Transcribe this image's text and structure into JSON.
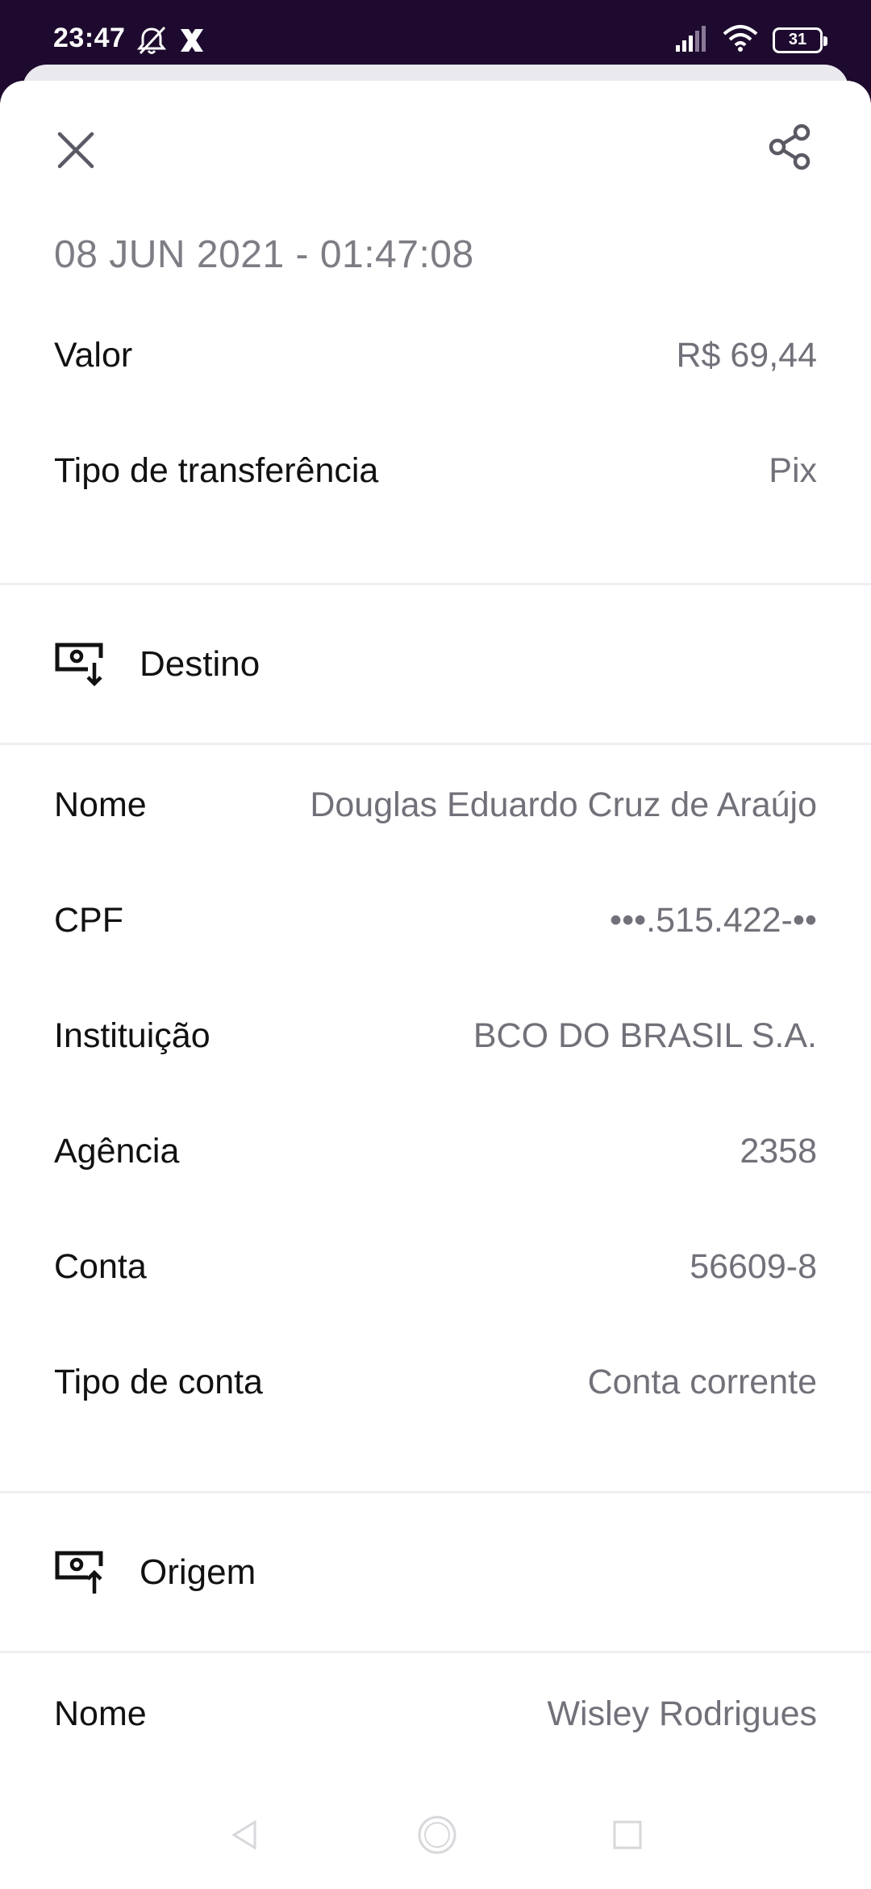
{
  "status_bar": {
    "time": "23:47",
    "battery": "31",
    "icons": [
      "alarm-off-icon",
      "x-app-icon",
      "signal-icon",
      "wifi-icon",
      "battery-icon"
    ]
  },
  "header": {
    "close_icon": "close-icon",
    "share_icon": "share-icon"
  },
  "transaction": {
    "date": "08 JUN 2021 - 01:47:08",
    "rows": [
      {
        "label": "Valor",
        "value": "R$ 69,44"
      },
      {
        "label": "Tipo de transferência",
        "value": "Pix"
      }
    ]
  },
  "destino": {
    "title": "Destino",
    "icon": "money-in-icon",
    "rows": [
      {
        "label": "Nome",
        "value": "Douglas Eduardo Cruz de Araújo"
      },
      {
        "label": "CPF",
        "value": "•••.515.422-••"
      },
      {
        "label": "Instituição",
        "value": "BCO DO BRASIL S.A."
      },
      {
        "label": "Agência",
        "value": "2358"
      },
      {
        "label": "Conta",
        "value": "56609-8"
      },
      {
        "label": "Tipo de conta",
        "value": "Conta corrente"
      }
    ]
  },
  "origem": {
    "title": "Origem",
    "icon": "money-out-icon",
    "rows": [
      {
        "label": "Nome",
        "value": "Wisley Rodrigues"
      }
    ]
  },
  "nav_bar": {
    "icons": [
      "back-icon",
      "home-icon",
      "recents-icon"
    ]
  }
}
